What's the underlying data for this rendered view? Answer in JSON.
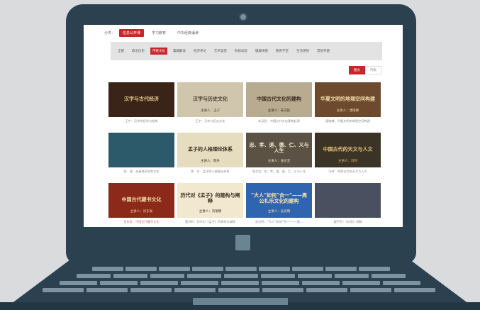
{
  "top_nav": {
    "label": "分类：",
    "tabs": [
      {
        "label": "信息公开课",
        "active": true
      },
      {
        "label": "学习教育",
        "active": false
      },
      {
        "label": "中华经典诵读",
        "active": false
      }
    ]
  },
  "categories": [
    {
      "label": "全部",
      "active": false
    },
    {
      "label": "政治历史",
      "active": false
    },
    {
      "label": "传统文化",
      "active": true
    },
    {
      "label": "典籍解读",
      "active": false
    },
    {
      "label": "经济评论",
      "active": false
    },
    {
      "label": "艺术鉴赏",
      "active": false
    },
    {
      "label": "科技动态",
      "active": false
    },
    {
      "label": "健康讲座",
      "active": false
    },
    {
      "label": "教育学堂",
      "active": false
    },
    {
      "label": "生活感悟",
      "active": false
    },
    {
      "label": "其他专题",
      "active": false
    }
  ],
  "view_toggle": {
    "grid_label": "图文",
    "list_label": "列表"
  },
  "cards": [
    {
      "thumb_title": "汉字与古代经济",
      "speaker": "",
      "caption": "王宁：汉字的经济与结构",
      "bg": "#3a2418",
      "fg": "#e3c58a"
    },
    {
      "thumb_title": "汉字与历史文化",
      "speaker": "主讲人：王宁",
      "caption": "王宁：汉字与历史文化",
      "bg": "#cfc6ad",
      "fg": "#4a3e30"
    },
    {
      "thumb_title": "中国古代文化的建构",
      "speaker": "主讲人：朱汉民",
      "caption": "朱汉民：中国古代文化建构起源",
      "bg": "#b8ab8f",
      "fg": "#3a2c20"
    },
    {
      "thumb_title": "华夏文明的地理空间构建",
      "speaker": "主讲人：唐晓峰",
      "caption": "唐晓峰：华夏文明的地理空间构建",
      "bg": "#6d4a2d",
      "fg": "#f0d8a8"
    },
    {
      "thumb_title": "",
      "speaker": "",
      "caption": "钱　逊：先秦诸子的孝文化",
      "bg": "#2c5a6a",
      "fg": "#f2e6c8"
    },
    {
      "thumb_title": "孟子的人格理论体系",
      "speaker": "主讲人：陈升",
      "caption": "陈　升：孟子的人格理论体系",
      "bg": "#e6dcc0",
      "fg": "#3a2c20"
    },
    {
      "thumb_title": "忠、孝、道、德、仁、义与人生",
      "speaker": "主讲人：张文宝",
      "caption": "张文宝：忠、孝、道、德、仁、义与人生",
      "bg": "#5b5245",
      "fg": "#f0e6cc"
    },
    {
      "thumb_title": "中国古代的天文与人文",
      "speaker": "主讲人：冯时",
      "caption": "冯时：中国古代的天文与人文",
      "bg": "#3b3326",
      "fg": "#e8c27a"
    },
    {
      "thumb_title": "中国古代藏书文化",
      "speaker": "主讲人：肖东发",
      "caption": "肖东发：中国古代藏书文化",
      "bg": "#8b2a1a",
      "fg": "#f4dca2"
    },
    {
      "thumb_title": "历代对《孟子》的建构与阐释",
      "speaker": "主讲人：刘瑞明",
      "caption": "董洪利：历代对《孟子》的建构与阐释",
      "bg": "#f1e8cf",
      "fg": "#3a2c20"
    },
    {
      "thumb_title": "“大人”如何“合一”——周公礼乐文化的建构",
      "speaker": "主讲人：吴光明",
      "caption": "吴光明：“大人”如何“合一”——周…",
      "bg": "#2f64b0",
      "fg": "#ffe9a8"
    },
    {
      "thumb_title": "",
      "speaker": "",
      "caption": "楼宇烈：《论语》讲解",
      "bg": "#4a5060",
      "fg": "#ffffff"
    }
  ]
}
